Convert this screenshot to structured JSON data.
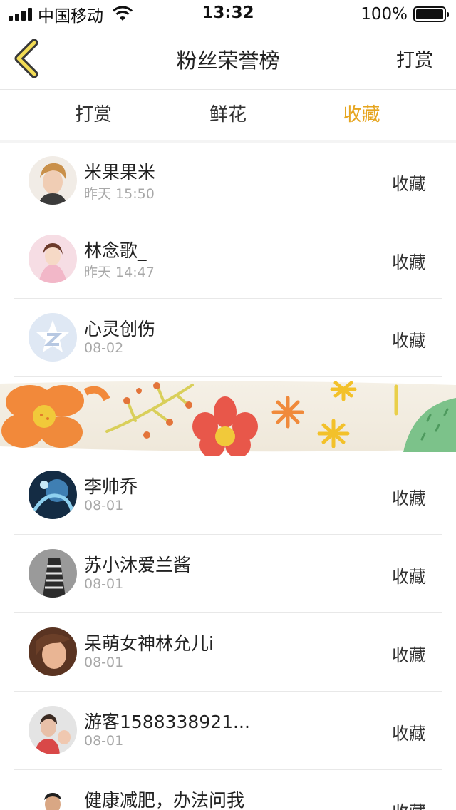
{
  "status_bar": {
    "carrier": "中国移动",
    "time": "13:32",
    "battery": "100%"
  },
  "nav": {
    "title": "粉丝荣誉榜",
    "action": "打赏"
  },
  "tabs": [
    {
      "label": "打赏",
      "active": false
    },
    {
      "label": "鲜花",
      "active": false
    },
    {
      "label": "收藏",
      "active": true
    }
  ],
  "accent_color": "#e6a51f",
  "rows": [
    {
      "name": "米果果米",
      "time": "昨天 15:50",
      "action": "收藏",
      "avatar_color": "#e9d7c6"
    },
    {
      "name": "林念歌_",
      "time": "昨天 14:47",
      "action": "收藏",
      "avatar_color": "#f3d3dc"
    },
    {
      "name": "心灵创伤",
      "time": "08-02",
      "action": "收藏",
      "avatar_color": "#dfe8f4"
    },
    {
      "name": "李帅乔",
      "time": "08-01",
      "action": "收藏",
      "avatar_color": "#1f3d5c"
    },
    {
      "name": "苏小沐爱兰酱",
      "time": "08-01",
      "action": "收藏",
      "avatar_color": "#5e5e5e"
    },
    {
      "name": "呆萌女神林允儿i",
      "time": "08-01",
      "action": "收藏",
      "avatar_color": "#8a5a3c"
    },
    {
      "name": "游客1588338921...",
      "time": "08-01",
      "action": "收藏",
      "avatar_color": "#d9b7b0"
    },
    {
      "name": "健康减肥，办法问我",
      "time": "",
      "action": "收藏",
      "avatar_color": "#f0f0f0"
    }
  ]
}
